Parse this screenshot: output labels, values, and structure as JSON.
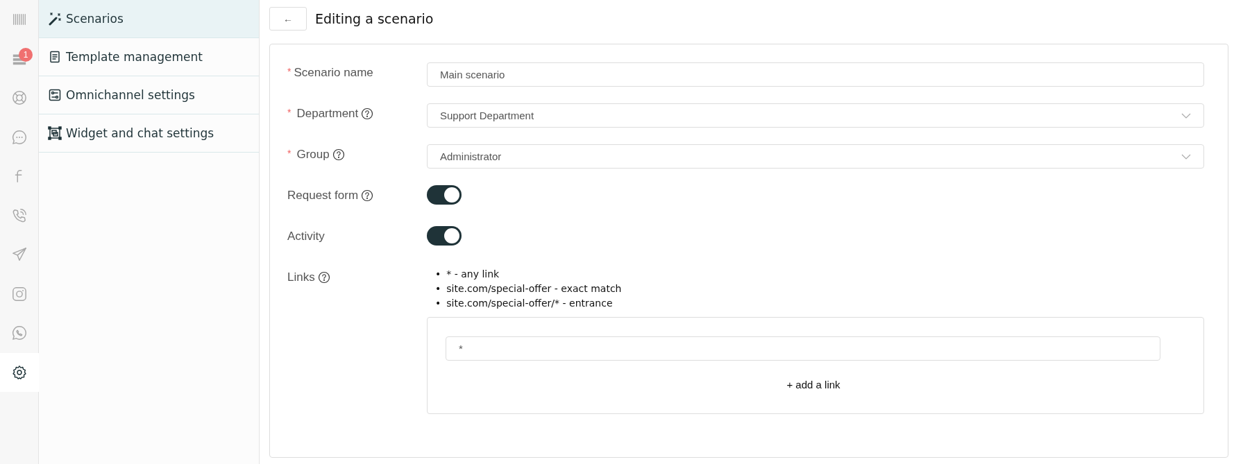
{
  "rail": [
    {
      "kind": "barcode",
      "selected": false
    },
    {
      "kind": "layers",
      "selected": false,
      "badge": "1"
    },
    {
      "kind": "lifebuoy",
      "selected": false
    },
    {
      "kind": "chat",
      "selected": false
    },
    {
      "kind": "f",
      "selected": false
    },
    {
      "kind": "phone",
      "selected": false
    },
    {
      "kind": "send",
      "selected": false
    },
    {
      "kind": "camera",
      "selected": false
    },
    {
      "kind": "callbubble",
      "selected": false
    },
    {
      "kind": "gear",
      "selected": true
    }
  ],
  "sidebar": {
    "items": [
      {
        "kind": "wand",
        "label": "Scenarios",
        "selected": true
      },
      {
        "kind": "doc",
        "label": "Template management",
        "selected": false
      },
      {
        "kind": "sliders",
        "label": "Omnichannel settings",
        "selected": false
      },
      {
        "kind": "frame",
        "label": "Widget and chat settings",
        "selected": false
      }
    ]
  },
  "header": {
    "back": "←",
    "title": "Editing a scenario"
  },
  "form": {
    "fields": [
      {
        "kind": "text",
        "label": "Scenario name",
        "required": true,
        "help": false,
        "value": "Main scenario"
      },
      {
        "kind": "select",
        "label": "Department",
        "required": true,
        "help": true,
        "value": "Support Department"
      },
      {
        "kind": "select",
        "label": "Group",
        "required": true,
        "help": true,
        "value": "Administrator"
      },
      {
        "kind": "toggle",
        "label": "Request form",
        "required": false,
        "help": true,
        "on": true
      },
      {
        "kind": "toggle",
        "label": "Activity",
        "required": false,
        "help": false,
        "on": true
      },
      {
        "kind": "links",
        "label": "Links",
        "required": false,
        "help": true,
        "marker": "•",
        "hints": [
          "* - any link",
          "site.com/special-offer - exact match",
          "site.com/special-offer/* - entrance"
        ],
        "links": [
          "*"
        ],
        "add": "+ add a link"
      }
    ]
  }
}
